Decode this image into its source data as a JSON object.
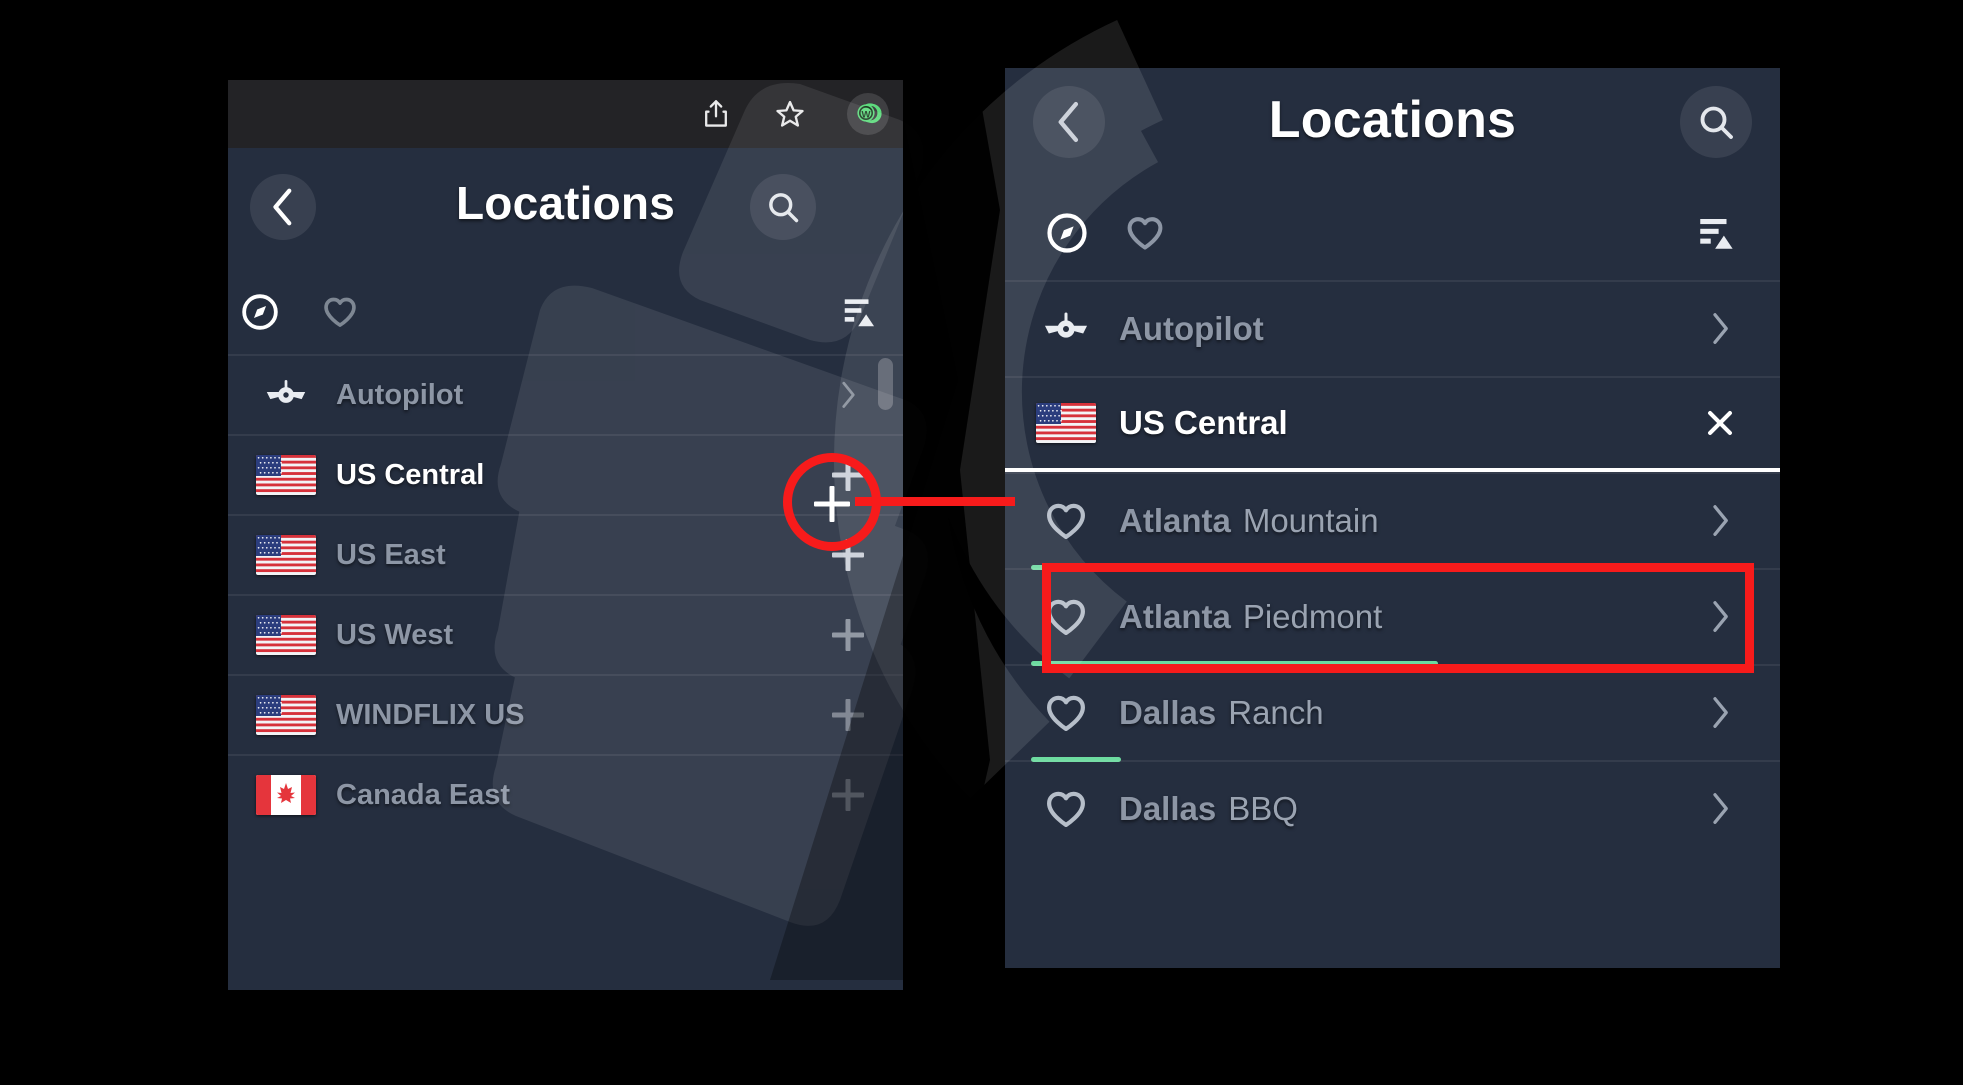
{
  "browser_toolbar": {
    "icons": [
      {
        "name": "share-icon",
        "glyph": "share"
      },
      {
        "name": "bookmark-star-icon",
        "glyph": "star"
      },
      {
        "name": "windscribe-logo-icon",
        "glyph": "W",
        "color": "#5ddb7d"
      }
    ]
  },
  "left_panel": {
    "header": {
      "back_label": "‹",
      "title": "Locations",
      "search_label": "search-icon"
    },
    "tabs": [
      {
        "name": "compass-tab",
        "icon": "compass-icon",
        "active": true
      },
      {
        "name": "favourites-tab",
        "icon": "heart-icon",
        "active": false
      }
    ],
    "sort_button": {
      "name": "sort-icon",
      "label": "sort"
    },
    "rows": [
      {
        "icon": "airplane-icon",
        "name": "Autopilot",
        "sub": "",
        "action": "chevron",
        "bright": false
      },
      {
        "icon": "flag-us",
        "name": "US Central",
        "sub": "",
        "action": "plus",
        "bright": true
      },
      {
        "icon": "flag-us",
        "name": "US East",
        "sub": "",
        "action": "plus",
        "bright": false
      },
      {
        "icon": "flag-us",
        "name": "US West",
        "sub": "",
        "action": "plus",
        "bright": false
      },
      {
        "icon": "flag-us",
        "name": "WINDFLIX US",
        "sub": "",
        "action": "plus",
        "bright": false
      },
      {
        "icon": "flag-ca",
        "name": "Canada East",
        "sub": "",
        "action": "plus",
        "bright": false
      }
    ]
  },
  "right_panel": {
    "header": {
      "back_label": "‹",
      "title": "Locations",
      "search_label": "search-icon"
    },
    "tabs": [
      {
        "name": "compass-tab",
        "icon": "compass-icon",
        "active": true
      },
      {
        "name": "favourites-tab",
        "icon": "heart-icon",
        "active": false
      }
    ],
    "sort_button": {
      "name": "sort-icon",
      "label": "sort"
    },
    "rows": [
      {
        "icon": "airplane-icon",
        "name": "Autopilot",
        "sub": "",
        "action": "chevron",
        "bright": false,
        "load": null
      },
      {
        "icon": "flag-us",
        "name": "US Central",
        "sub": "",
        "action": "close",
        "bright": true,
        "load": null
      },
      {
        "icon": "heart-icon",
        "name": "Atlanta",
        "sub": "Mountain",
        "action": "chevron",
        "bright": false,
        "load": 22
      },
      {
        "icon": "heart-icon",
        "name": "Atlanta",
        "sub": "Piedmont",
        "action": "chevron",
        "bright": false,
        "load": 59
      },
      {
        "icon": "heart-icon",
        "name": "Dallas",
        "sub": "Ranch",
        "action": "chevron",
        "bright": false,
        "load": 13
      },
      {
        "icon": "heart-icon",
        "name": "Dallas",
        "sub": "BBQ",
        "action": "chevron",
        "bright": false,
        "load": null
      }
    ]
  },
  "annotations": {
    "highlight_color": "#f71b1b",
    "circle_target": "add-location-plus-button",
    "box_target": "atlanta-mountain-row"
  }
}
